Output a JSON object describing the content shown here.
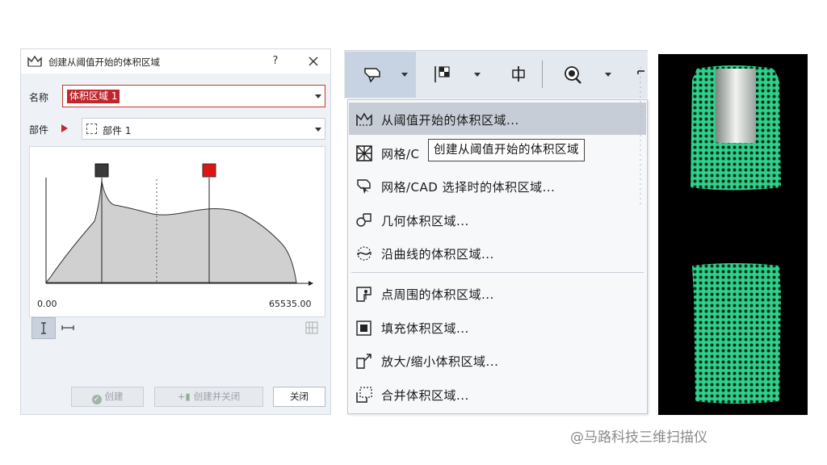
{
  "dialog": {
    "title": "创建从阈值开始的体积区域",
    "help_label": "?",
    "name_label": "名称",
    "name_value": "体积区域 1",
    "part_label": "部件",
    "part_value": "部件 1",
    "axis_min": "0.00",
    "axis_max": "65535.00",
    "buttons": {
      "create": "创建",
      "create_and_close": "创建并关闭",
      "close": "关闭"
    }
  },
  "toolbar": {
    "items": [
      "volume-region-tool-icon",
      "grid-select-icon",
      "midpoint-icon",
      "magnify-icon",
      "overflow-icon"
    ]
  },
  "menu": {
    "items": [
      {
        "label": "从阈值开始的体积区域...",
        "icon": "threshold-region-icon",
        "highlighted": true
      },
      {
        "label": "网格/C",
        "icon": "mesh-cad-icon"
      },
      {
        "label": "网格/CAD 选择时的体积区域...",
        "icon": "mesh-cad-select-icon"
      },
      {
        "label": "几何体积区域...",
        "icon": "geometry-region-icon"
      },
      {
        "label": "沿曲线的体积区域...",
        "icon": "curve-region-icon"
      },
      {
        "label": "点周围的体积区域...",
        "icon": "point-region-icon"
      },
      {
        "label": "填充体积区域...",
        "icon": "fill-region-icon"
      },
      {
        "label": "放大/缩小体积区域...",
        "icon": "grow-shrink-region-icon"
      },
      {
        "label": "合并体积区域...",
        "icon": "merge-region-icon"
      }
    ],
    "tooltip": "创建从阈值开始的体积区域"
  },
  "viewport": {
    "lattice_color": "#2fd08a",
    "background": "#000000"
  },
  "watermark": "@马路科技三维扫描仪",
  "colors": {
    "accent_red": "#c0272d",
    "menu_highlight": "#c6cdd6",
    "dialog_bg": "#eef2f7"
  }
}
